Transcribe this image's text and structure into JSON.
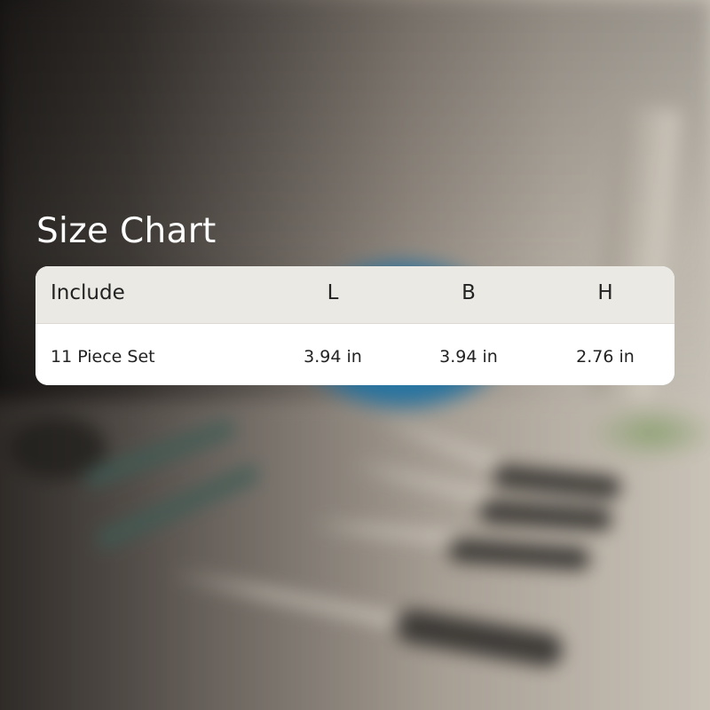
{
  "size_chart": {
    "title": "Size Chart",
    "headers": [
      "Include",
      "L",
      "B",
      "H"
    ],
    "rows": [
      [
        "11 Piece Set",
        "3.94 in",
        "3.94 in",
        "2.76 in"
      ]
    ]
  },
  "background": {
    "description_colors": {
      "bowl": "#2a8fc4",
      "handles": "#2b2927",
      "teal_handles": "#3f5c55"
    }
  }
}
